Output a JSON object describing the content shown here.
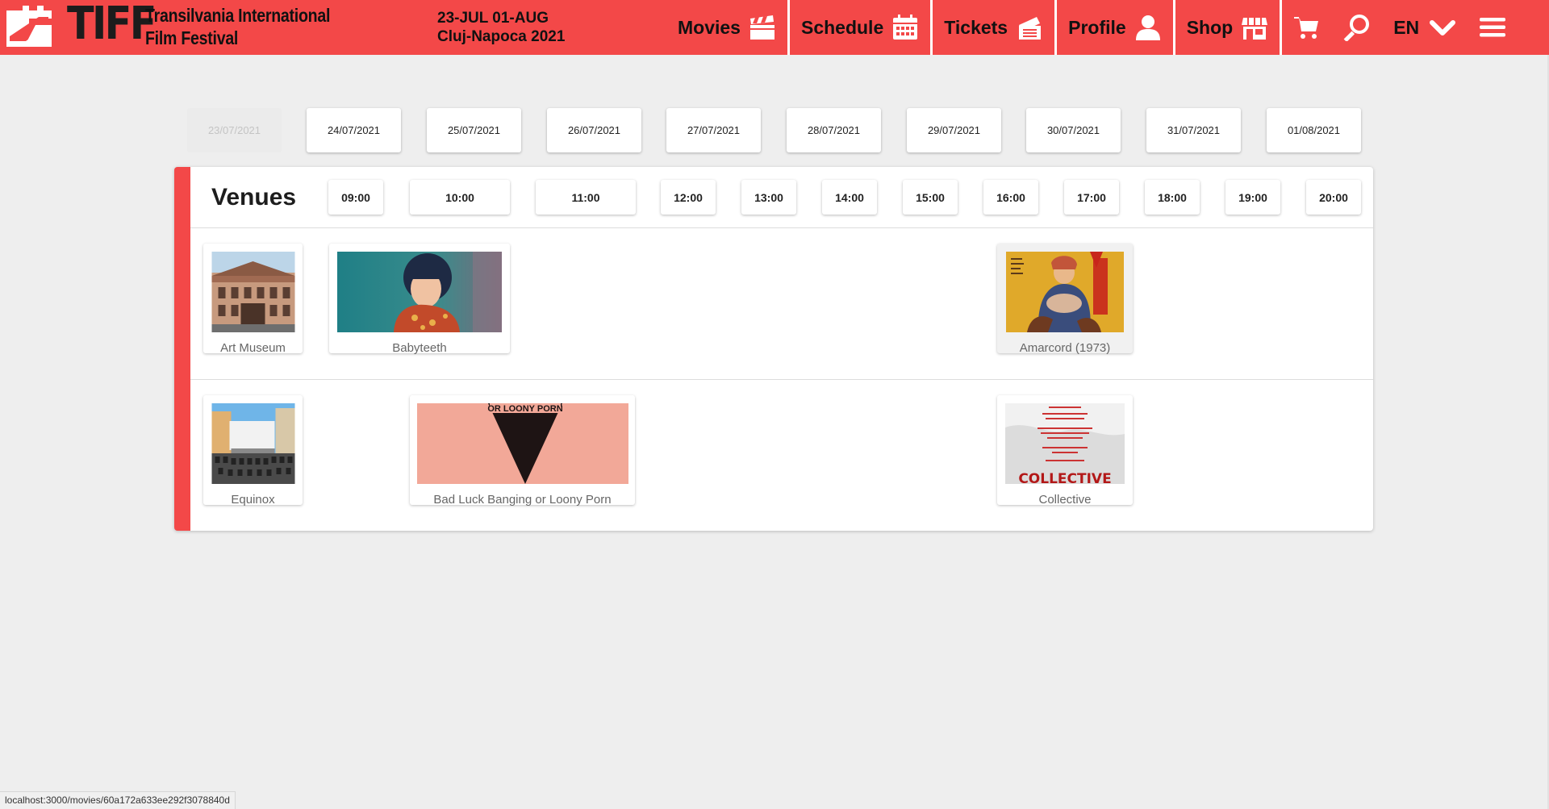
{
  "header": {
    "brand": "TIFF",
    "festival_line1": "Transilvania International",
    "festival_line2": "Film Festival",
    "dates_line1": "23-JUL 01-AUG",
    "dates_line2": "Cluj-Napoca 2021",
    "accent_color": "#f34848",
    "nav": [
      {
        "label": "Movies",
        "icon": "clapperboard-icon"
      },
      {
        "label": "Schedule",
        "icon": "calendar-icon"
      },
      {
        "label": "Tickets",
        "icon": "ticket-icon"
      },
      {
        "label": "Profile",
        "icon": "user-icon"
      },
      {
        "label": "Shop",
        "icon": "store-icon"
      }
    ],
    "language": "EN"
  },
  "dates": [
    {
      "label": "23/07/2021",
      "disabled": true
    },
    {
      "label": "24/07/2021",
      "disabled": false
    },
    {
      "label": "25/07/2021",
      "disabled": false
    },
    {
      "label": "26/07/2021",
      "disabled": false
    },
    {
      "label": "27/07/2021",
      "disabled": false
    },
    {
      "label": "28/07/2021",
      "disabled": false
    },
    {
      "label": "29/07/2021",
      "disabled": false
    },
    {
      "label": "30/07/2021",
      "disabled": false
    },
    {
      "label": "31/07/2021",
      "disabled": false
    },
    {
      "label": "01/08/2021",
      "disabled": false
    }
  ],
  "schedule": {
    "title": "Venues",
    "times": [
      "09:00",
      "10:00",
      "11:00",
      "12:00",
      "13:00",
      "14:00",
      "15:00",
      "16:00",
      "17:00",
      "18:00",
      "19:00",
      "20:00"
    ],
    "rows": [
      {
        "venue": "Art Museum",
        "screenings": [
          {
            "title": "Babyteeth"
          },
          {
            "title": "Amarcord (1973)"
          }
        ]
      },
      {
        "venue": "Equinox",
        "screenings": [
          {
            "title": "Bad Luck Banging or Loony Porn",
            "poster_text": "OR LOONY PORN"
          },
          {
            "title": "Collective",
            "poster_text": "COLLECTIVE"
          }
        ]
      }
    ]
  },
  "status_url": "localhost:3000/movies/60a172a633ee292f3078840d"
}
